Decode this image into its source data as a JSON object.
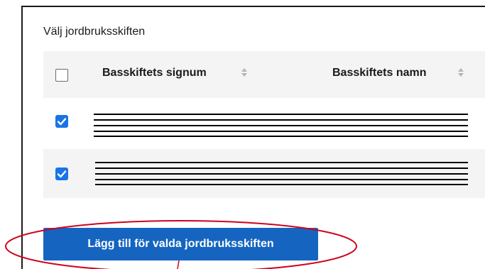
{
  "section": {
    "title": "Välj jordbruksskiften"
  },
  "table": {
    "columns": [
      {
        "label": "Basskiftets signum",
        "sort_icon": "sort-icon"
      },
      {
        "label": "Basskiftets namn",
        "sort_icon": "sort-icon"
      }
    ],
    "select_all_checked": false,
    "rows": [
      {
        "checked": true,
        "content": "redacted"
      },
      {
        "checked": true,
        "content": "redacted"
      }
    ]
  },
  "actions": {
    "add_button_label": "Lägg till för valda jordbruksskiften"
  },
  "colors": {
    "accent": "#1a73e8",
    "button": "#1565c0",
    "annotation": "#d0021b"
  }
}
